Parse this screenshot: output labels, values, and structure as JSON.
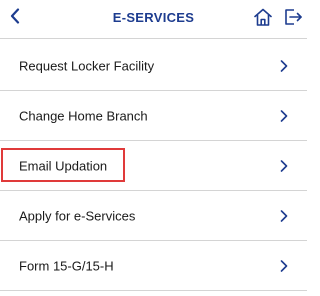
{
  "header": {
    "title": "E-SERVICES",
    "back_icon": "chevron-left-icon",
    "home_icon": "home-icon",
    "logout_icon": "logout-icon",
    "accent_color": "#1d3c8f"
  },
  "menu": {
    "items": [
      {
        "label": "Request Locker Facility",
        "icon": "chevron-right-icon"
      },
      {
        "label": "Change Home Branch",
        "icon": "chevron-right-icon"
      },
      {
        "label": "Email Updation",
        "icon": "chevron-right-icon",
        "highlighted": true
      },
      {
        "label": "Apply for e-Services",
        "icon": "chevron-right-icon"
      },
      {
        "label": "Form 15-G/15-H",
        "icon": "chevron-right-icon"
      }
    ]
  },
  "highlight_color": "#e03a3a"
}
